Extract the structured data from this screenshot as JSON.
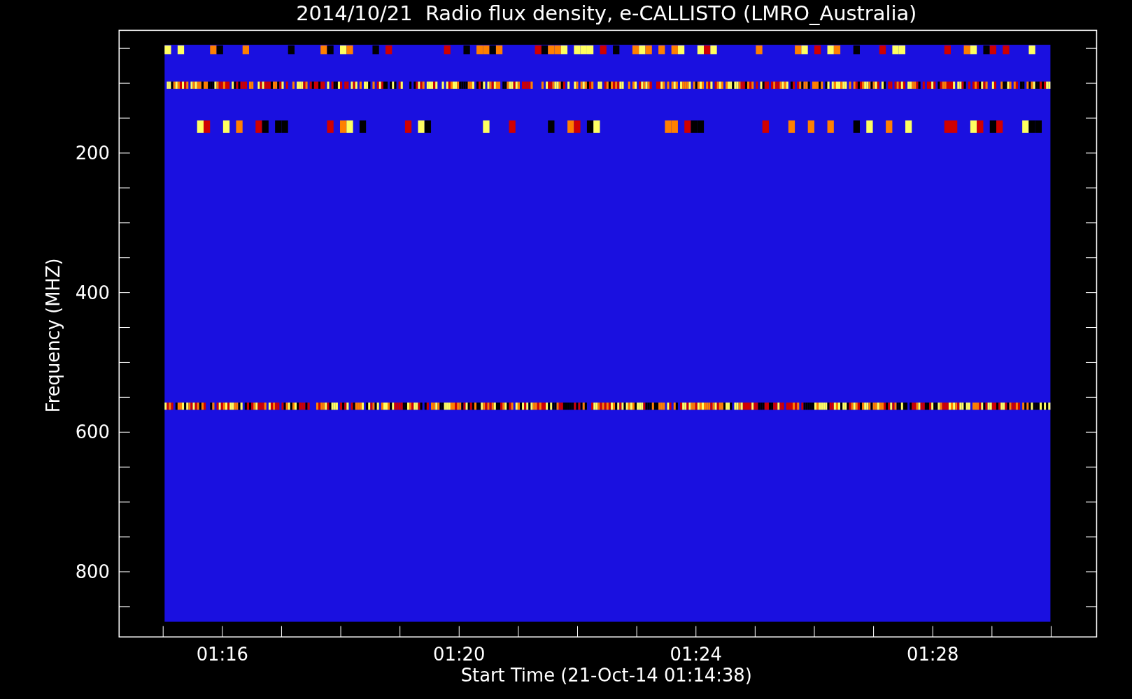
{
  "title": "2014/10/21  Radio flux density, e-CALLISTO (LMRO_Australia)",
  "y_axis": {
    "label": "Frequency (MHZ)",
    "tick_labels": [
      "200",
      "400",
      "600",
      "800"
    ]
  },
  "x_axis": {
    "label": "Start Time (21-Oct-14 01:14:38)",
    "tick_labels": [
      "01:16",
      "01:20",
      "01:24",
      "01:28"
    ]
  }
}
